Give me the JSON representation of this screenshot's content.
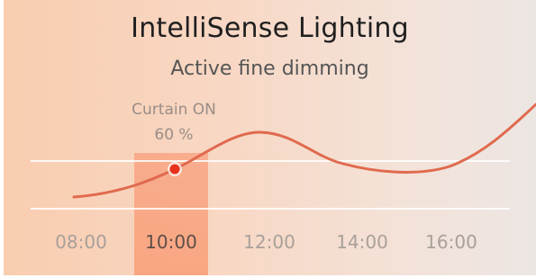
{
  "header": {
    "title": "IntelliSense Lighting",
    "subtitle": "Active fine dimming"
  },
  "annotation": {
    "label": "Curtain ON",
    "value": "60 %"
  },
  "chart_data": {
    "type": "line",
    "x_ticks": [
      "08:00",
      "10:00",
      "12:00",
      "14:00",
      "16:00"
    ],
    "highlighted_tick": "10:00",
    "marker_label": "Curtain ON 60 %",
    "grid": true,
    "colors": {
      "line": "#e06a4e",
      "marker": "#e8321c",
      "highlight_band": "#f88c64"
    }
  }
}
